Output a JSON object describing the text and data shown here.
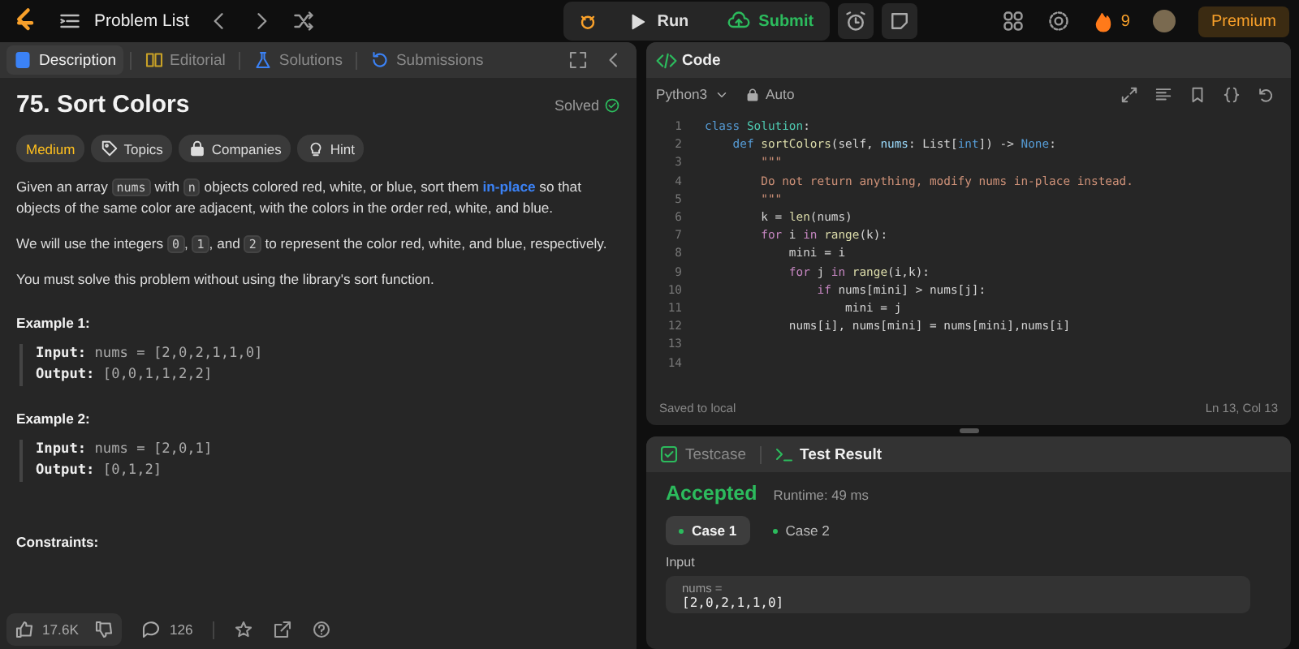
{
  "topbar": {
    "problem_list": "Problem List",
    "run": "Run",
    "submit": "Submit",
    "streak": "9",
    "premium": "Premium"
  },
  "left_tabs": [
    {
      "label": "Description",
      "selected": true,
      "kind": "doc"
    },
    {
      "label": "Editorial",
      "selected": false,
      "kind": "book"
    },
    {
      "label": "Solutions",
      "selected": false,
      "kind": "flask"
    },
    {
      "label": "Submissions",
      "selected": false,
      "kind": "history"
    }
  ],
  "problem": {
    "title": "75. Sort Colors",
    "status": "Solved",
    "tags": [
      {
        "label": "Medium",
        "kind": "difficulty"
      },
      {
        "label": "Topics",
        "kind": "tag"
      },
      {
        "label": "Companies",
        "kind": "lock"
      },
      {
        "label": "Hint",
        "kind": "bulb"
      }
    ],
    "paragraphs": [
      [
        {
          "kind": "text",
          "text": "Given an array "
        },
        {
          "kind": "code",
          "text": "nums"
        },
        {
          "kind": "text",
          "text": " with "
        },
        {
          "kind": "code",
          "text": "n"
        },
        {
          "kind": "text",
          "text": " objects colored red, white, or blue, sort them "
        },
        {
          "kind": "link",
          "text": "in-place"
        },
        {
          "kind": "text",
          "text": " so that objects of the same color are adjacent, with the colors in the order red, white, and blue."
        }
      ],
      [
        {
          "kind": "text",
          "text": "We will use the integers "
        },
        {
          "kind": "code",
          "text": "0"
        },
        {
          "kind": "text",
          "text": ", "
        },
        {
          "kind": "code",
          "text": "1"
        },
        {
          "kind": "text",
          "text": ", and "
        },
        {
          "kind": "code",
          "text": "2"
        },
        {
          "kind": "text",
          "text": " to represent the color red, white, and blue, respectively."
        }
      ],
      [
        {
          "kind": "text",
          "text": "You must solve this problem without using the library's sort function."
        }
      ]
    ],
    "examples": [
      {
        "title": "Example 1:",
        "lines": [
          "**Input:** nums = [2,0,2,1,1,0]",
          "**Output:** [0,0,1,1,2,2]"
        ]
      },
      {
        "title": "Example 2:",
        "lines": [
          "**Input:** nums = [2,0,1]",
          "**Output:** [0,1,2]"
        ]
      }
    ],
    "constraints_title": "Constraints:"
  },
  "footer": {
    "likes": "17.6K",
    "comments": "126"
  },
  "code_panel": {
    "title": "Code",
    "language": "Python3",
    "mode": "Auto",
    "lines": [
      {
        "number": "1",
        "tokens": [
          {
            "kind": "kw",
            "text": "class "
          },
          {
            "kind": "cls",
            "text": "Solution"
          },
          {
            "kind": "plain",
            "text": ":"
          }
        ]
      },
      {
        "number": "2",
        "tokens": [
          {
            "kind": "kw",
            "text": "    def "
          },
          {
            "kind": "fn",
            "text": "sortColors"
          },
          {
            "kind": "plain",
            "text": "(self, "
          },
          {
            "kind": "var",
            "text": "nums"
          },
          {
            "kind": "plain",
            "text": ": List["
          },
          {
            "kind": "kw",
            "text": "int"
          },
          {
            "kind": "plain",
            "text": "]) -> "
          },
          {
            "kind": "kw",
            "text": "None"
          },
          {
            "kind": "plain",
            "text": ":"
          }
        ]
      },
      {
        "number": "3",
        "tokens": [
          {
            "kind": "str",
            "text": "        \"\"\""
          }
        ]
      },
      {
        "number": "4",
        "tokens": [
          {
            "kind": "str",
            "text": "        Do not return anything, modify nums in-place instead."
          }
        ]
      },
      {
        "number": "5",
        "tokens": [
          {
            "kind": "str",
            "text": "        \"\"\""
          }
        ]
      },
      {
        "number": "6",
        "tokens": [
          {
            "kind": "plain",
            "text": "        k = "
          },
          {
            "kind": "fn",
            "text": "len"
          },
          {
            "kind": "plain",
            "text": "(nums)"
          }
        ]
      },
      {
        "number": "7",
        "tokens": [
          {
            "kind": "ctl",
            "text": "        for"
          },
          {
            "kind": "plain",
            "text": " i "
          },
          {
            "kind": "ctl",
            "text": "in "
          },
          {
            "kind": "fn",
            "text": "range"
          },
          {
            "kind": "plain",
            "text": "(k):"
          }
        ]
      },
      {
        "number": "8",
        "tokens": [
          {
            "kind": "plain",
            "text": "            mini = i"
          }
        ]
      },
      {
        "number": "9",
        "tokens": [
          {
            "kind": "ctl",
            "text": "            for"
          },
          {
            "kind": "plain",
            "text": " j "
          },
          {
            "kind": "ctl",
            "text": "in "
          },
          {
            "kind": "fn",
            "text": "range"
          },
          {
            "kind": "plain",
            "text": "(i,k):"
          }
        ]
      },
      {
        "number": "10",
        "tokens": [
          {
            "kind": "ctl",
            "text": "                if"
          },
          {
            "kind": "plain",
            "text": " nums[mini] > nums[j]:"
          }
        ]
      },
      {
        "number": "11",
        "tokens": [
          {
            "kind": "plain",
            "text": "                    mini = j"
          }
        ]
      },
      {
        "number": "12",
        "tokens": [
          {
            "kind": "plain",
            "text": "            nums[i], nums[mini] = nums[mini],nums[i]"
          }
        ]
      },
      {
        "number": "13"
      },
      {
        "number": "14"
      }
    ],
    "saved": "Saved to local",
    "cursor": "Ln 13, Col 13"
  },
  "result_panel": {
    "tabs": [
      {
        "label": "Testcase",
        "selected": false,
        "kind": "check"
      },
      {
        "label": "Test Result",
        "selected": true,
        "kind": "terminal"
      }
    ],
    "verdict": "Accepted",
    "runtime": "Runtime: 49 ms",
    "cases": [
      {
        "label": "Case 1",
        "selected": true
      },
      {
        "label": "Case 2",
        "selected": false
      }
    ],
    "input_label": "Input",
    "input_name": "nums =",
    "input_value": "[2,0,2,1,1,0]"
  }
}
